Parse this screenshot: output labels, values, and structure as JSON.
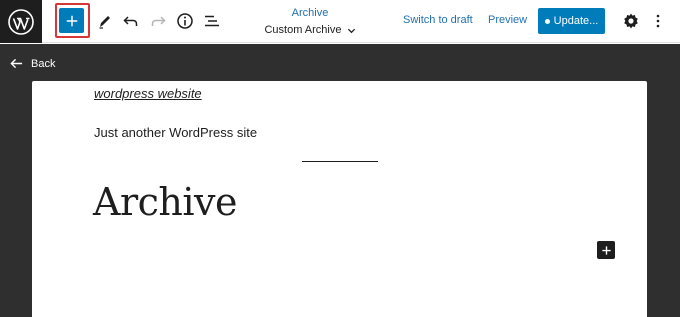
{
  "toolbar": {
    "logo_icon": "wordpress-logo-icon",
    "add_icon": "plus-icon",
    "tools_icon": "pencil-icon",
    "undo_icon": "undo-icon",
    "redo_icon": "redo-icon",
    "info_icon": "info-icon",
    "list_view_icon": "list-view-icon"
  },
  "document": {
    "type_label": "Archive",
    "template_name": "Custom Archive"
  },
  "actions": {
    "switch_to_draft": "Switch to draft",
    "preview": "Preview",
    "update": "Update...",
    "settings_icon": "gear-icon",
    "options_icon": "vertical-ellipsis-icon"
  },
  "back_label": "Back",
  "canvas": {
    "site_title": "wordpress website",
    "tagline": "Just another WordPress site",
    "heading": "Archive"
  },
  "colors": {
    "accent": "#007cba",
    "highlight": "#d63638",
    "dark_bg": "#2f2f2f"
  }
}
